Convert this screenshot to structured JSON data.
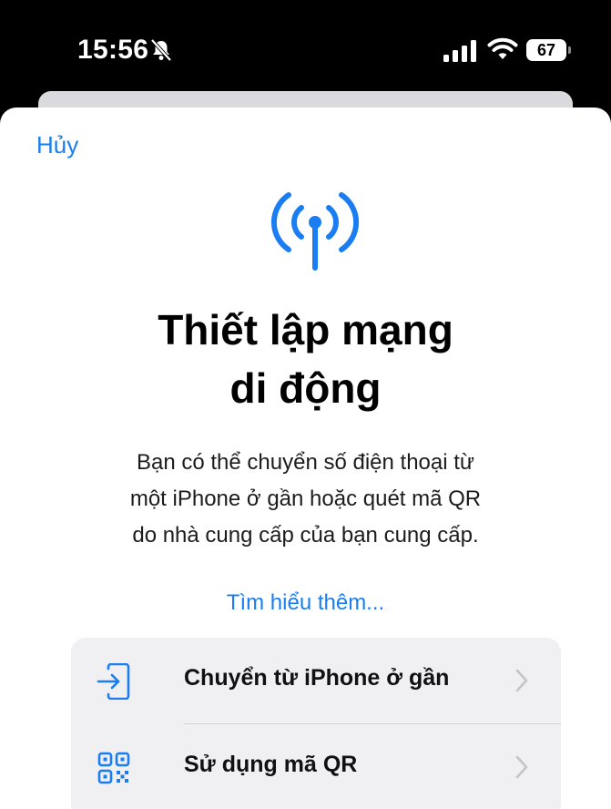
{
  "status_bar": {
    "time": "15:56",
    "battery": "67",
    "icons": [
      "bell-slash-icon",
      "cellular-signal-icon",
      "wifi-icon",
      "battery-icon"
    ]
  },
  "sheet": {
    "cancel_label": "Hủy",
    "icon": "cellular-antenna-icon",
    "title_line1": "Thiết lập mạng",
    "title_line2": "di động",
    "description_line1": "Bạn có thể chuyển số điện thoại từ",
    "description_line2": "một iPhone ở gần hoặc quét mã QR",
    "description_line3": "do nhà cung cấp của bạn cung cấp.",
    "learn_more_label": "Tìm hiểu thêm...",
    "options": [
      {
        "label": "Chuyển từ iPhone ở gần",
        "icon": "transfer-in-icon"
      },
      {
        "label": "Sử dụng mã QR",
        "icon": "qr-code-icon"
      }
    ]
  },
  "colors": {
    "accent": "#1a7ef2",
    "background": "#ffffff",
    "status_bar_bg": "#000000",
    "options_bg": "#f0f0f3"
  }
}
